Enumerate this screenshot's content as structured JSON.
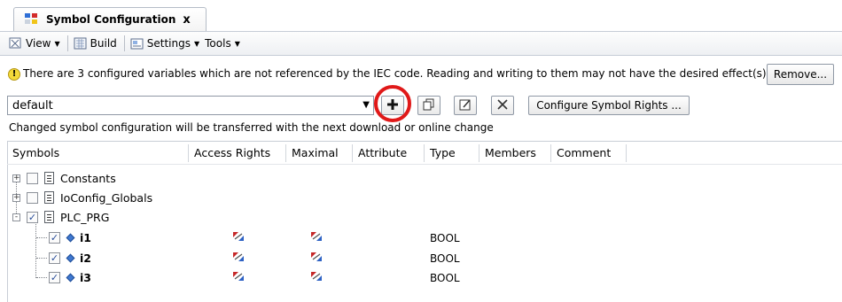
{
  "tab": {
    "title": "Symbol Configuration",
    "close": "x"
  },
  "toolbar": {
    "view": "View",
    "build": "Build",
    "settings": "Settings",
    "tools": "Tools"
  },
  "warning": {
    "message": "There are 3 configured variables which are not referenced by the IEC code. Reading and writing to them may not have the desired effect(s).",
    "remove_label": "Remove..."
  },
  "config": {
    "selected": "default",
    "configure_rights_label": "Configure Symbol Rights ...",
    "hint": "Changed symbol configuration will be transferred with the next download or online change"
  },
  "columns": [
    "Symbols",
    "Access Rights",
    "Maximal",
    "Attribute",
    "Type",
    "Members",
    "Comment"
  ],
  "tree": [
    {
      "label": "Constants",
      "expander": "+",
      "checked": false
    },
    {
      "label": "IoConfig_Globals",
      "expander": "+",
      "checked": false
    },
    {
      "label": "PLC_PRG",
      "expander": "-",
      "checked": true,
      "children": [
        {
          "label": "i1",
          "checked": true,
          "type": "BOOL"
        },
        {
          "label": "i2",
          "checked": true,
          "type": "BOOL"
        },
        {
          "label": "i3",
          "checked": true,
          "type": "BOOL"
        }
      ]
    }
  ],
  "colors": {
    "highlight": "#e01919",
    "accent": "#3f78d0"
  }
}
